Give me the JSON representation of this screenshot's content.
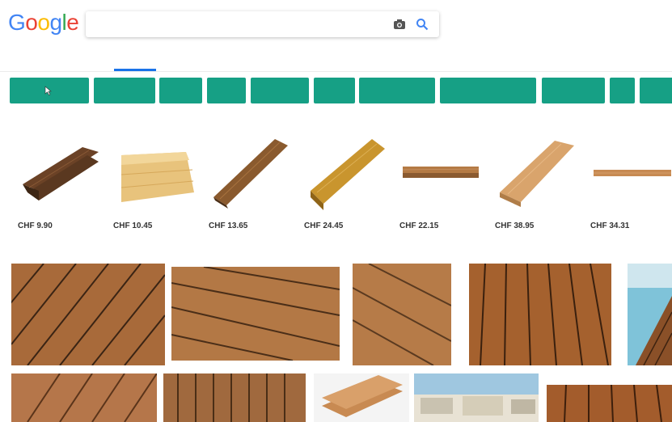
{
  "search": {
    "query": ""
  },
  "tabs": [
    {
      "label": ""
    },
    {
      "label": "",
      "active": true
    },
    {
      "label": ""
    },
    {
      "label": ""
    },
    {
      "label": ""
    },
    {
      "label": ""
    }
  ],
  "tools": {
    "settings": "",
    "tools": ""
  },
  "chips": [
    {
      "label": ""
    },
    {
      "label": ""
    },
    {
      "label": ""
    },
    {
      "label": ""
    },
    {
      "label": ""
    },
    {
      "label": ""
    },
    {
      "label": ""
    },
    {
      "label": ""
    },
    {
      "label": ""
    },
    {
      "label": ""
    },
    {
      "label": ""
    }
  ],
  "ads_label": "",
  "products": [
    {
      "price": "CHF 9.90",
      "store": ""
    },
    {
      "price": "CHF 10.45",
      "store": ""
    },
    {
      "price": "CHF 13.65",
      "store": ""
    },
    {
      "price": "CHF 24.45",
      "store": ""
    },
    {
      "price": "CHF 22.15",
      "store": ""
    },
    {
      "price": "CHF 38.95",
      "store": ""
    },
    {
      "price": "CHF 34.31",
      "store": ""
    }
  ],
  "colors": {
    "chip_bg": "#16a085",
    "accent": "#1a73e8"
  },
  "icons": [
    "camera-icon",
    "search-icon",
    "cursor-icon"
  ]
}
